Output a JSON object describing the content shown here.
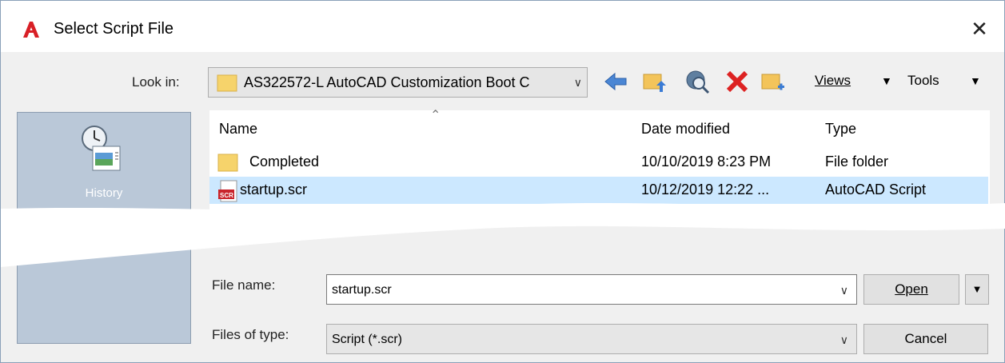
{
  "window": {
    "title": "Select Script File",
    "close_glyph": "✕"
  },
  "toolbar": {
    "look_in_label": "Look in:",
    "look_in_value": "AS322572-L AutoCAD Customization Boot C",
    "views_label": "Views",
    "tools_label": "Tools",
    "icons": [
      "back-icon",
      "up-folder-icon",
      "search-web-icon",
      "delete-icon",
      "new-folder-icon"
    ]
  },
  "places": {
    "items": [
      {
        "label": "History",
        "icon": "history-icon"
      }
    ]
  },
  "filelist": {
    "columns": {
      "name": "Name",
      "date": "Date modified",
      "type": "Type"
    },
    "rows": [
      {
        "name": "Completed",
        "date": "10/10/2019 8:23 PM",
        "type": "File folder",
        "icon": "folder-icon",
        "selected": false
      },
      {
        "name": "startup.scr",
        "date": "10/12/2019 12:22 ...",
        "type": "AutoCAD Script",
        "icon": "script-file-icon",
        "selected": true
      }
    ]
  },
  "footer": {
    "file_name_label": "File name:",
    "file_name_value": "startup.scr",
    "files_of_type_label": "Files of type:",
    "files_of_type_value": "Script (*.scr)",
    "open_label": "Open",
    "cancel_label": "Cancel"
  },
  "colors": {
    "selection": "#cce8ff",
    "places_bg": "#bac8d8",
    "app_red": "#d81f26"
  }
}
